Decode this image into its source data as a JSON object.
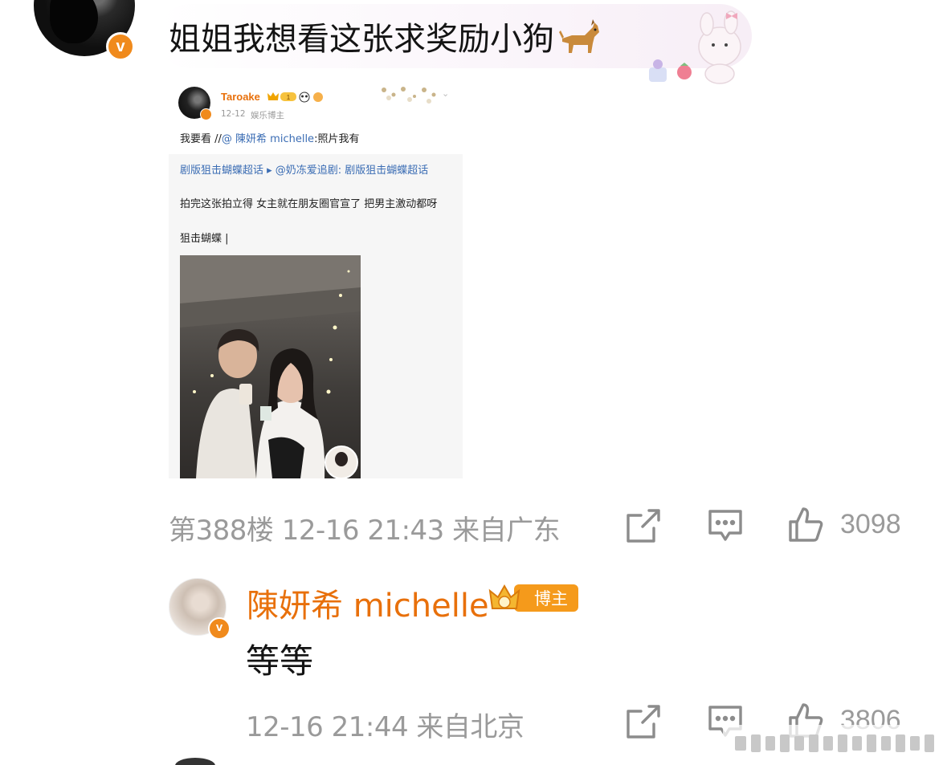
{
  "comment": {
    "text": "姐姐我想看这张求奖励小狗",
    "avatar_icon": "user-avatar",
    "verified_icon": "verified-v-badge",
    "emoji_icon": "dog-emoji-icon",
    "floor": "第388楼",
    "time": "12-16 21:43",
    "location": "来自广东",
    "likes": "3098"
  },
  "embedded_post": {
    "username": "Taroake",
    "badge_level": "1",
    "date": "12-12",
    "role": "娱乐博主",
    "repost_prefix": "我要看 //",
    "repost_mention": "@ 陳妍希 michelle",
    "repost_suffix": ":照片我有",
    "topic_line": "剧版狙击蝴蝶超话 ▸ @奶冻爱追剧: 剧版狙击蝴蝶超话",
    "body_line1": "拍完这张拍立得 女主就在朋友圈官宣了 把男主激动都呀",
    "body_line2": "狙击蝴蝶 |"
  },
  "reply": {
    "name": "陳妍希 michelle",
    "badge_label": "博主",
    "text": "等等",
    "verified_icon": "verified-v-badge",
    "time": "12-16 21:44",
    "location": "来自北京",
    "likes": "3806"
  },
  "icons": {
    "share": "share-icon",
    "comment": "comment-icon",
    "like": "thumbs-up-icon"
  },
  "colors": {
    "accent_orange": "#e8700b",
    "meta_gray": "#9a9a9a",
    "mention_blue": "#3b6db4"
  }
}
